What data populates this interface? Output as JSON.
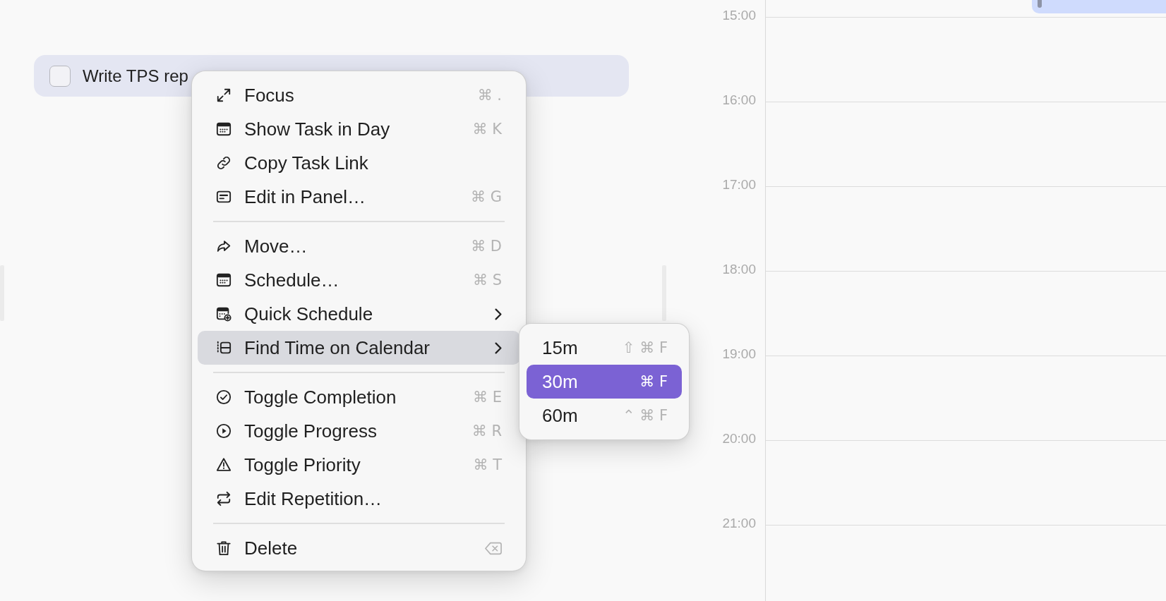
{
  "tasks": [
    {
      "title": "Write TPS rep",
      "checked": false,
      "selected": true
    }
  ],
  "context_menu": {
    "groups": [
      {
        "items": [
          {
            "label": "Focus",
            "kind": "plain",
            "shortcut": "⌘ .",
            "selected": false
          },
          {
            "label": "Show Task in Day",
            "kind": "plain",
            "shortcut": "⌘ K",
            "selected": false
          },
          {
            "label": "Copy Task Link",
            "kind": "plain",
            "selected": false
          },
          {
            "label": "Edit in Panel…",
            "kind": "plain",
            "shortcut": "⌘ G",
            "selected": false
          }
        ]
      },
      {
        "items": [
          {
            "label": "Move…",
            "kind": "plain",
            "shortcut": "⌘ D",
            "selected": false
          },
          {
            "label": "Schedule…",
            "kind": "plain",
            "shortcut": "⌘ S",
            "selected": false
          },
          {
            "label": "Quick Schedule",
            "kind": "submenu",
            "selected": false
          },
          {
            "label": "Find Time on Calendar",
            "kind": "submenu",
            "selected": true,
            "submenu": {
              "items": [
                {
                  "label": "15m",
                  "shortcut": "⇧ ⌘ F",
                  "selected": false
                },
                {
                  "label": "30m",
                  "shortcut": "⌘ F",
                  "selected": true
                },
                {
                  "label": "60m",
                  "shortcut": "⌃ ⌘ F",
                  "selected": false
                }
              ]
            }
          }
        ]
      },
      {
        "items": [
          {
            "label": "Toggle Completion",
            "kind": "plain",
            "shortcut": "⌘ E",
            "selected": false
          },
          {
            "label": "Toggle Progress",
            "kind": "plain",
            "shortcut": "⌘ R",
            "selected": false
          },
          {
            "label": "Toggle Priority",
            "kind": "plain",
            "shortcut": "⌘ T",
            "selected": false
          },
          {
            "label": "Edit Repetition…",
            "kind": "plain",
            "selected": false
          }
        ]
      },
      {
        "items": [
          {
            "label": "Delete",
            "kind": "erase",
            "selected": false
          }
        ]
      }
    ]
  },
  "calendar": {
    "hours": [
      "15:00",
      "16:00",
      "17:00",
      "18:00",
      "19:00",
      "20:00",
      "21:00"
    ]
  }
}
